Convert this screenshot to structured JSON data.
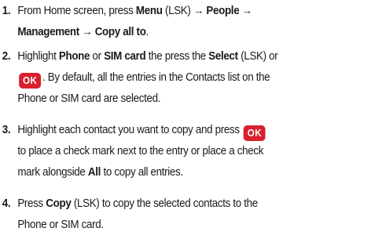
{
  "steps": [
    {
      "number": "1.",
      "lines": [
        [
          {
            "t": "From Home screen, press ",
            "b": false
          },
          {
            "t": "Menu",
            "b": true
          },
          {
            "t": " (LSK) ",
            "b": false
          },
          {
            "t": "→ People →",
            "b": true
          }
        ],
        [
          {
            "t": "Management  → Copy all to",
            "b": true
          },
          {
            "t": ".",
            "b": false
          }
        ]
      ]
    },
    {
      "number": "2.",
      "lines": [
        [
          {
            "t": "Highlight ",
            "b": false
          },
          {
            "t": "Phone",
            "b": true
          },
          {
            "t": " or ",
            "b": false
          },
          {
            "t": "SIM card",
            "b": true
          },
          {
            "t": " the press the ",
            "b": false
          },
          {
            "t": "Select",
            "b": true
          },
          {
            "t": " (LSK) or",
            "b": false
          }
        ],
        [
          {
            "key": "OK"
          },
          {
            "t": ". By default, all the entries in the Contacts list on the",
            "b": false
          }
        ],
        [
          {
            "t": "Phone or SIM card are selected.",
            "b": false
          }
        ]
      ]
    },
    {
      "number": "3.",
      "lines": [
        [
          {
            "t": "Highlight each contact you want to copy and press ",
            "b": false
          },
          {
            "key": "OK"
          }
        ],
        [
          {
            "t": "to place a check mark next to the entry or place a check",
            "b": false
          }
        ],
        [
          {
            "t": "mark alongside ",
            "b": false
          },
          {
            "t": "All",
            "b": true
          },
          {
            "t": " to copy all entries.",
            "b": false
          }
        ]
      ]
    },
    {
      "number": "4.",
      "lines": [
        [
          {
            "t": "Press ",
            "b": false
          },
          {
            "t": "Copy",
            "b": true
          },
          {
            "t": " (LSK) to copy the selected contacts to the",
            "b": false
          }
        ],
        [
          {
            "t": "Phone or SIM card.",
            "b": false
          }
        ]
      ]
    }
  ]
}
